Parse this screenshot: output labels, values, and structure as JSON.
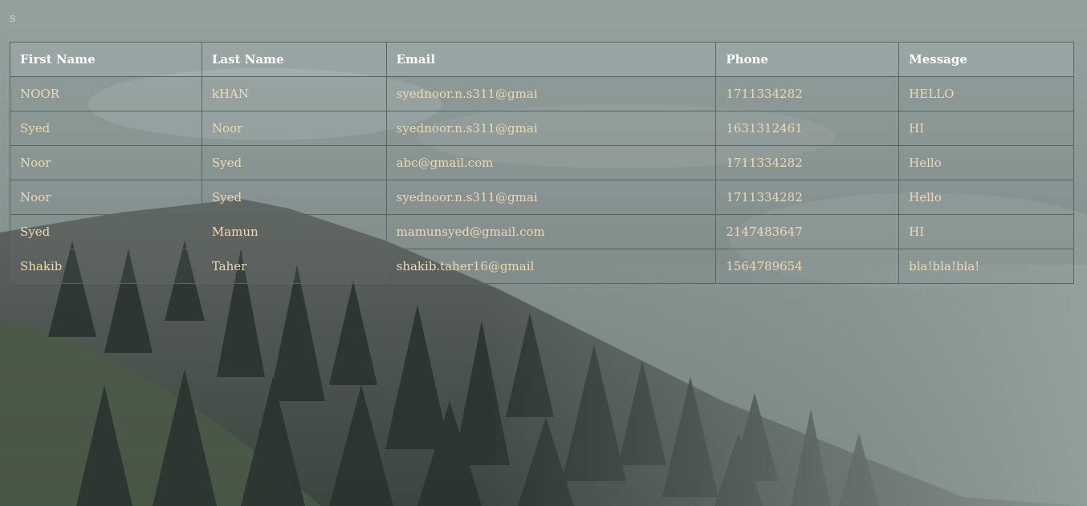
{
  "page": {
    "corner_text": "s"
  },
  "table": {
    "headers": [
      "First Name",
      "Last Name",
      "Email",
      "Phone",
      "Message"
    ],
    "rows": [
      [
        "NOOR",
        "kHAN",
        "syednoor.n.s311@gmai",
        "1711334282",
        "HELLO"
      ],
      [
        "Syed",
        "Noor",
        "syednoor.n.s311@gmai",
        "1631312461",
        "HI"
      ],
      [
        "Noor",
        "Syed",
        "abc@gmail.com",
        "1711334282",
        "Hello"
      ],
      [
        "Noor",
        "Syed",
        "syednoor.n.s311@gmai",
        "1711334282",
        "Hello"
      ],
      [
        "Syed",
        "Mamun",
        "mamunsyed@gmail.com",
        "2147483647",
        "HI"
      ],
      [
        "Shakib",
        "Taher",
        "shakib.taher16@gmail",
        "1564789654",
        "bla!bla!bla!"
      ]
    ]
  },
  "colors": {
    "header_text": "#ffffff",
    "cell_text": "#f0d9ae",
    "border": "#5a6461"
  }
}
